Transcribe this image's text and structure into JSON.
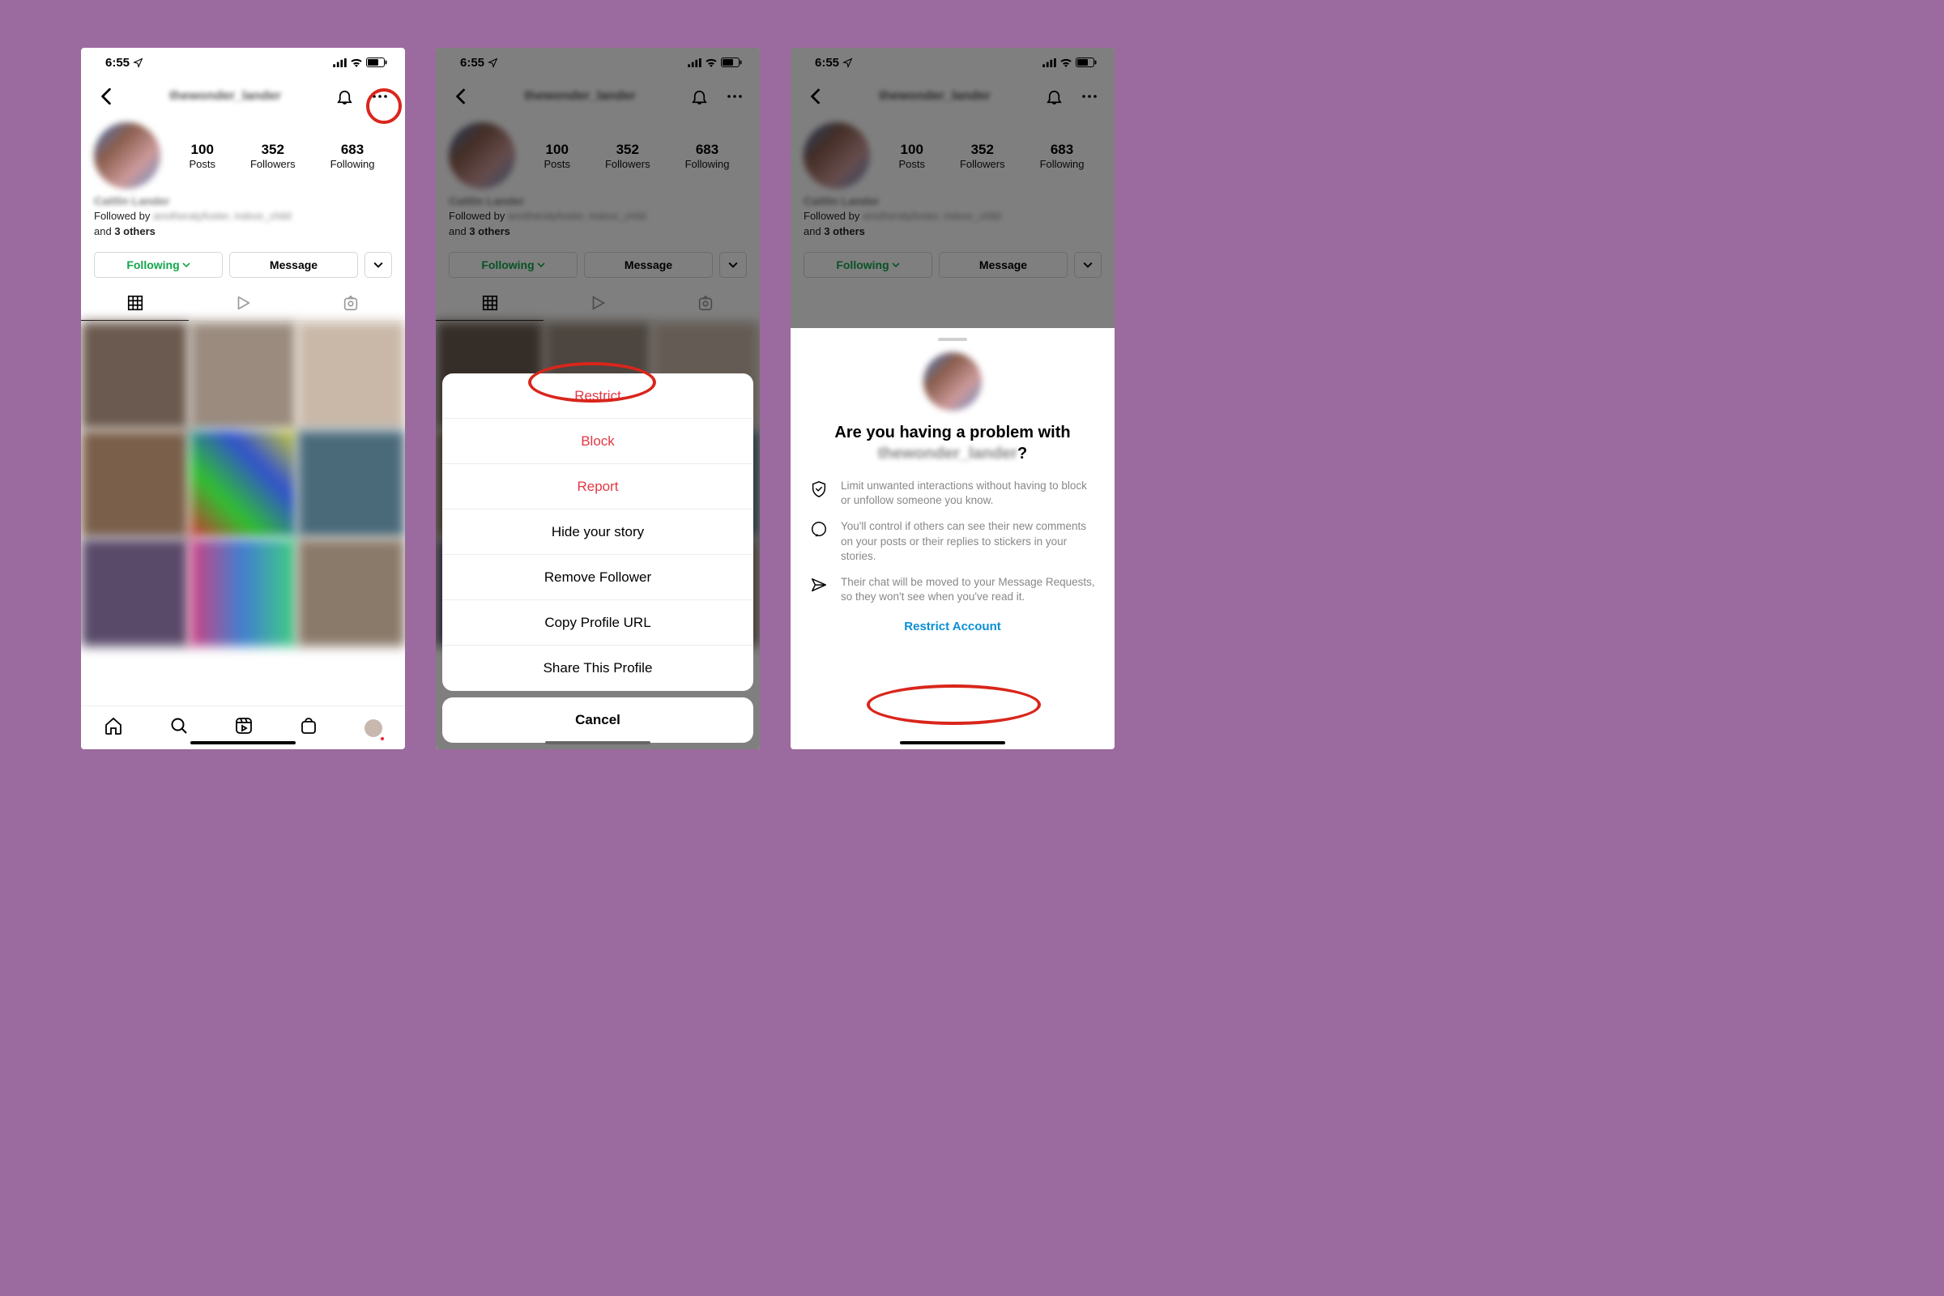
{
  "status": {
    "time": "6:55",
    "signal": "ill",
    "wifi": true,
    "battery": 0.6
  },
  "profile": {
    "username": "thewonder_lander",
    "display_name": "Caitlin Lander",
    "stats": [
      {
        "num": "100",
        "label": "Posts"
      },
      {
        "num": "352",
        "label": "Followers"
      },
      {
        "num": "683",
        "label": "Following"
      }
    ],
    "followed_by_prefix": "Followed by ",
    "followed_by_names": "anotheratyfoster, indoor_child",
    "followed_by_suffix_and": "and ",
    "followed_by_suffix_others": "3 others"
  },
  "buttons": {
    "following": "Following",
    "message": "Message"
  },
  "action_sheet": {
    "items": [
      {
        "label": "Restrict",
        "style": "red"
      },
      {
        "label": "Block",
        "style": "red"
      },
      {
        "label": "Report",
        "style": "red"
      },
      {
        "label": "Hide your story",
        "style": "normal"
      },
      {
        "label": "Remove Follower",
        "style": "normal"
      },
      {
        "label": "Copy Profile URL",
        "style": "normal"
      },
      {
        "label": "Share This Profile",
        "style": "normal"
      }
    ],
    "cancel": "Cancel"
  },
  "restrict_sheet": {
    "title_prefix": "Are you having a problem with ",
    "title_username": "thewonder_lander",
    "title_suffix": "?",
    "bullets": [
      "Limit unwanted interactions without having to block or unfollow someone you know.",
      "You'll control if others can see their new comments on your posts or their replies to stickers in your stories.",
      "Their chat will be moved to your Message Requests, so they won't see when you've read it."
    ],
    "cta": "Restrict Account"
  }
}
